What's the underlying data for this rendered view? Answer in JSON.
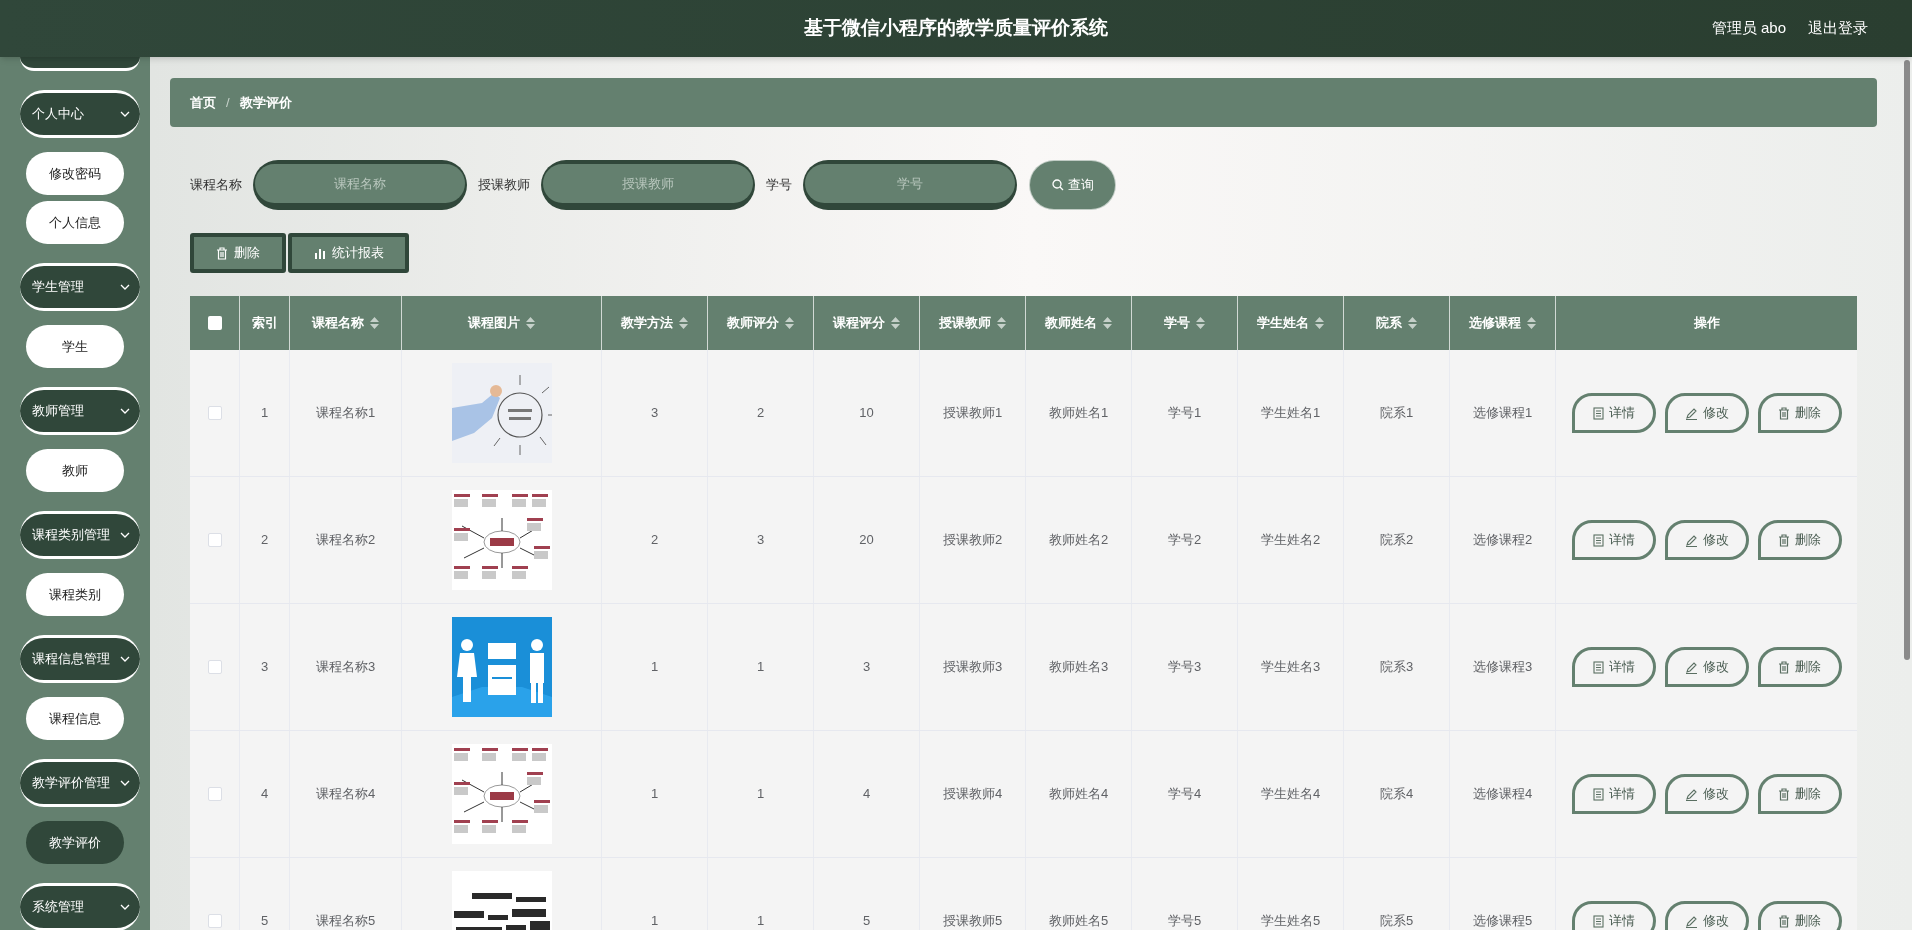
{
  "header": {
    "title": "基于微信小程序的教学质量评价系统",
    "user": "管理员 abo",
    "logout": "退出登录"
  },
  "sidebar": {
    "groups": [
      {
        "label": "个人中心",
        "children": [
          {
            "label": "修改密码",
            "selected": false
          },
          {
            "label": "个人信息",
            "selected": false
          }
        ]
      },
      {
        "label": "学生管理",
        "children": [
          {
            "label": "学生",
            "selected": false
          }
        ]
      },
      {
        "label": "教师管理",
        "children": [
          {
            "label": "教师",
            "selected": false
          }
        ]
      },
      {
        "label": "课程类别管理",
        "children": [
          {
            "label": "课程类别",
            "selected": false
          }
        ]
      },
      {
        "label": "课程信息管理",
        "children": [
          {
            "label": "课程信息",
            "selected": false
          }
        ]
      },
      {
        "label": "教学评价管理",
        "children": [
          {
            "label": "教学评价",
            "selected": true
          }
        ]
      },
      {
        "label": "系统管理"
      }
    ]
  },
  "breadcrumb": {
    "items": [
      "首页",
      "教学评价"
    ],
    "separator": "/"
  },
  "search": {
    "fields": [
      {
        "label": "课程名称",
        "placeholder": "课程名称"
      },
      {
        "label": "授课教师",
        "placeholder": "授课教师"
      },
      {
        "label": "学号",
        "placeholder": "学号"
      }
    ],
    "button": "查询"
  },
  "toolbar": [
    {
      "label": "删除",
      "kind": "delete"
    },
    {
      "label": "统计报表",
      "kind": "chart"
    }
  ],
  "table": {
    "select_all": {
      "checked": false
    },
    "columns": [
      {
        "label": "索引",
        "sortable": false
      },
      {
        "label": "课程名称",
        "sortable": true
      },
      {
        "label": "课程图片",
        "sortable": true
      },
      {
        "label": "教学方法",
        "sortable": true
      },
      {
        "label": "教师评分",
        "sortable": true
      },
      {
        "label": "课程评分",
        "sortable": true
      },
      {
        "label": "授课教师",
        "sortable": true
      },
      {
        "label": "教师姓名",
        "sortable": true
      },
      {
        "label": "学号",
        "sortable": true
      },
      {
        "label": "学生姓名",
        "sortable": true
      },
      {
        "label": "院系",
        "sortable": true
      },
      {
        "label": "选修课程",
        "sortable": true
      },
      {
        "label": "操作",
        "sortable": false
      }
    ],
    "rows": [
      {
        "checked": false,
        "index": "1",
        "course": "课程名称1",
        "values": [
          "3",
          "2",
          "10",
          "授课教师1",
          "教师姓名1",
          "学号1",
          "学生姓名1",
          "院系1",
          "选修课程1"
        ],
        "actions": [
          {
            "label": "详情",
            "kind": "detail"
          },
          {
            "label": "修改",
            "kind": "edit"
          },
          {
            "label": "删除",
            "kind": "delete"
          }
        ]
      },
      {
        "checked": false,
        "index": "2",
        "course": "课程名称2",
        "values": [
          "2",
          "3",
          "20",
          "授课教师2",
          "教师姓名2",
          "学号2",
          "学生姓名2",
          "院系2",
          "选修课程2"
        ],
        "actions": [
          {
            "label": "详情",
            "kind": "detail"
          },
          {
            "label": "修改",
            "kind": "edit"
          },
          {
            "label": "删除",
            "kind": "delete"
          }
        ]
      },
      {
        "checked": false,
        "index": "3",
        "course": "课程名称3",
        "values": [
          "1",
          "1",
          "3",
          "授课教师3",
          "教师姓名3",
          "学号3",
          "学生姓名3",
          "院系3",
          "选修课程3"
        ],
        "actions": [
          {
            "label": "详情",
            "kind": "detail"
          },
          {
            "label": "修改",
            "kind": "edit"
          },
          {
            "label": "删除",
            "kind": "delete"
          }
        ]
      },
      {
        "checked": false,
        "index": "4",
        "course": "课程名称4",
        "values": [
          "1",
          "1",
          "4",
          "授课教师4",
          "教师姓名4",
          "学号4",
          "学生姓名4",
          "院系4",
          "选修课程4"
        ],
        "actions": [
          {
            "label": "详情",
            "kind": "detail"
          },
          {
            "label": "修改",
            "kind": "edit"
          },
          {
            "label": "删除",
            "kind": "delete"
          }
        ]
      },
      {
        "checked": false,
        "index": "5",
        "course": "课程名称5",
        "values": [
          "1",
          "1",
          "5",
          "授课教师5",
          "教师姓名5",
          "学号5",
          "学生姓名5",
          "院系5",
          "选修课程5"
        ],
        "actions": [
          {
            "label": "详情",
            "kind": "detail"
          },
          {
            "label": "修改",
            "kind": "edit"
          },
          {
            "label": "删除",
            "kind": "delete"
          }
        ]
      }
    ]
  }
}
